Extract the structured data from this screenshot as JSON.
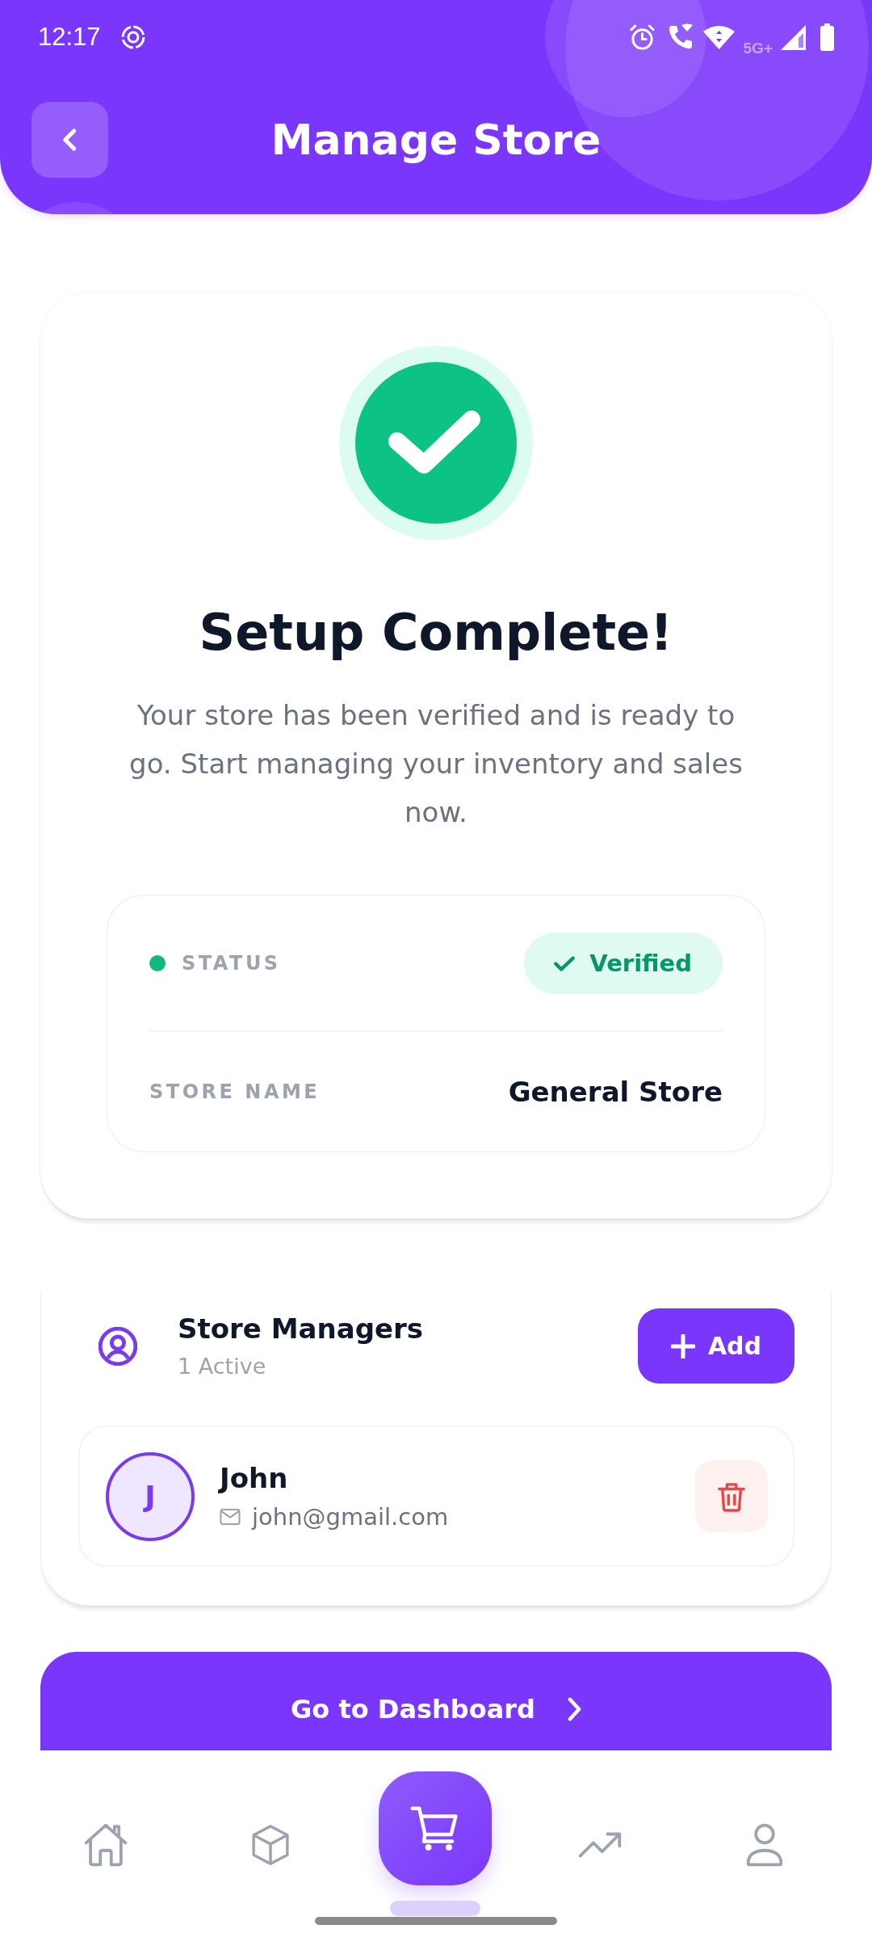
{
  "status_bar": {
    "time": "12:17",
    "network": "5G+"
  },
  "header": {
    "title": "Manage Store"
  },
  "setup": {
    "title": "Setup Complete!",
    "message": "Your store has been verified and is ready to go. Start managing your inventory and sales now.",
    "details": [
      {
        "kind": "status",
        "label": "STATUS",
        "value": "Verified"
      },
      {
        "kind": "text",
        "label": "STORE NAME",
        "value": "General Store"
      }
    ]
  },
  "managers": {
    "title": "Store Managers",
    "count": "1 Active",
    "add_button": "Add",
    "people": [
      {
        "initial": "J",
        "name": "John",
        "email": "john@gmail.com"
      }
    ]
  },
  "primary_button": "Go to Dashboard",
  "bottom_nav": [
    {
      "selected": false
    },
    {
      "selected": false
    },
    {
      "selected": true
    },
    {
      "selected": false
    },
    {
      "selected": false
    }
  ]
}
